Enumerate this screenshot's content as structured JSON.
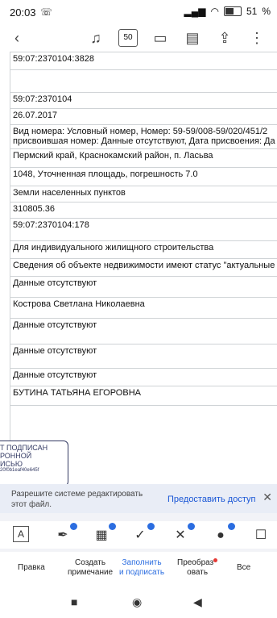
{
  "status": {
    "time": "20:03",
    "battery": "51"
  },
  "toolbar": {
    "page_count": "50"
  },
  "document": {
    "rows": [
      "59:07:2370104:3828",
      "",
      "59:07:2370104",
      "26.07.2017",
      "Вид номера: Условный номер, Номер: 59-59/008-59/020/451/2",
      "присвоившая номер: Данные отсутствуют, Дата присвоения: Да",
      "Пермский край, Краснокамский район, п. Ласьва",
      "1048, Уточненная площадь, погрешность 7.0",
      "Земли населенных пунктов",
      "310805.36",
      "59:07:2370104:178",
      "Для индивидуального жилищного строительства",
      "Сведения об объекте недвижимости имеют статус \"актуальные",
      "Данные отсутствуют",
      "Кострова Светлана Николаевна",
      "Данные отсутствуют",
      "Данные отсутствуют",
      "Данные отсутствуют",
      "БУТИНА ТАТЬЯНА ЕГОРОВНА"
    ],
    "stamp": {
      "line1": "Т ПОДПИСАН",
      "line2": "РОННОЙ",
      "line3": "ИСЬЮ",
      "hash": "20f0b1eaf40e645f"
    }
  },
  "banner": {
    "message_line1": "Разрешите системе редактировать",
    "message_line2": "этот файл.",
    "allow": "Предоставить доступ"
  },
  "menu": {
    "edit": "Правка",
    "create_note_1": "Создать",
    "create_note_2": "примечание",
    "fill_sign_1": "Заполнить",
    "fill_sign_2": "и подписать",
    "convert_1": "Преобраз",
    "convert_2": "овать",
    "all": "Все"
  }
}
